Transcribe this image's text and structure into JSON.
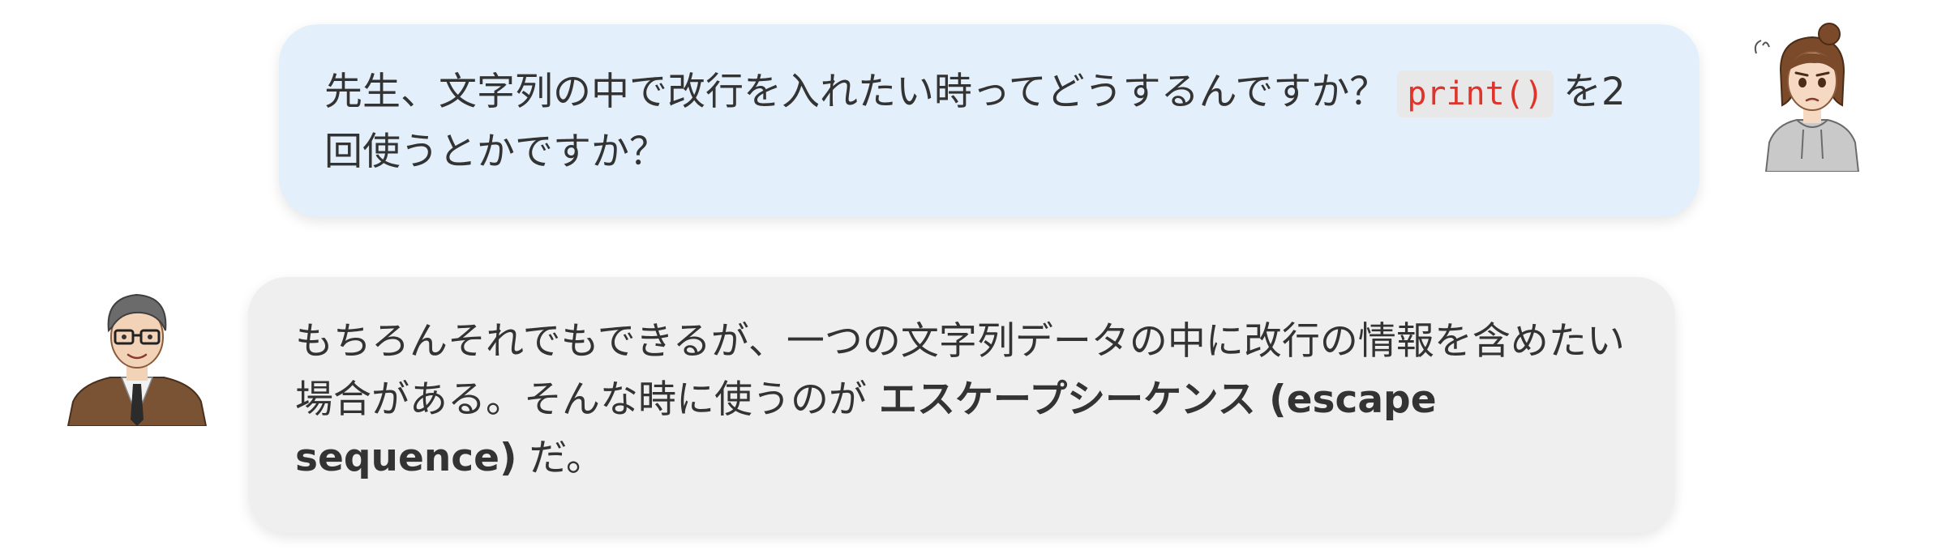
{
  "conversation": {
    "messages": [
      {
        "speaker": "student",
        "avatar_icon": "student-girl-avatar-icon",
        "text_before_code": "先生、文字列の中で改行を入れたい時ってどうするんですか？",
        "code": "print()",
        "text_after_code": "を2回使うとかですか？",
        "bubble_color": "#e3f0fb"
      },
      {
        "speaker": "teacher",
        "avatar_icon": "teacher-man-avatar-icon",
        "text_before_bold": "もちろんそれでもできるが、一つの文字列データの中に改行の情報を含めたい場合がある。そんな時に使うのが ",
        "bold_term": "エスケープシーケンス (escape sequence)",
        "text_after_bold": " だ。",
        "bubble_color": "#efefef"
      }
    ],
    "colors": {
      "text": "#333333",
      "code_text": "#e0332a",
      "code_background": "#e8e8e8"
    }
  }
}
